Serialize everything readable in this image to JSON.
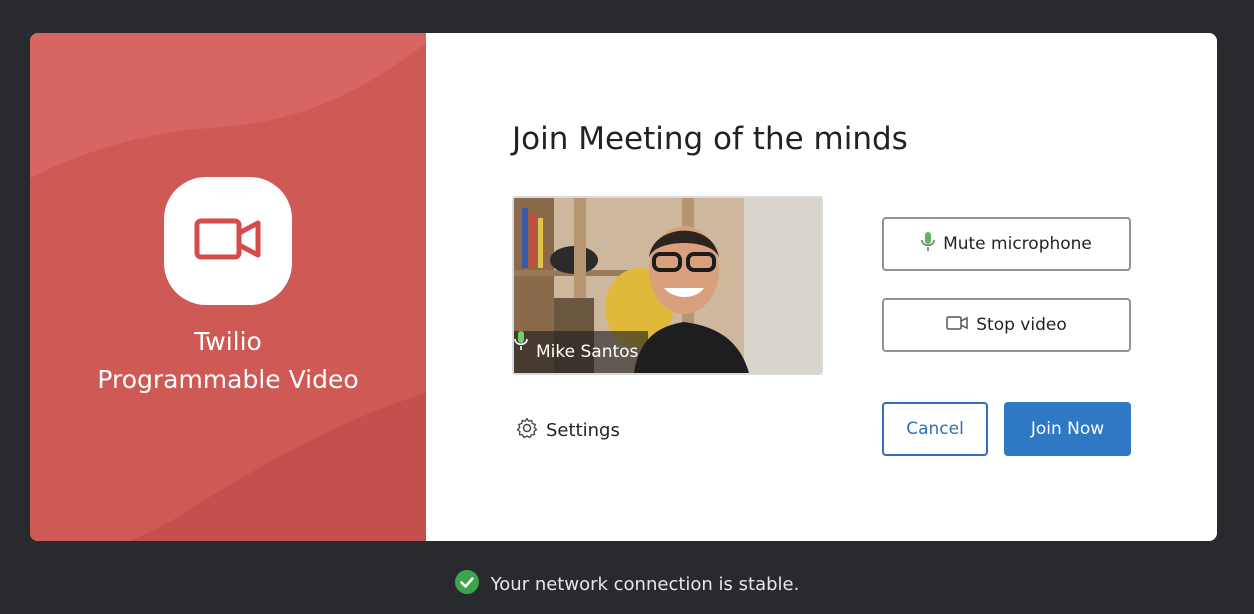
{
  "brand": {
    "line1": "Twilio",
    "line2": "Programmable Video",
    "accent": "#cf5955"
  },
  "dialog": {
    "title": "Join Meeting of the minds",
    "participant_name": "Mike Santos",
    "mute_label": "Mute microphone",
    "stop_video_label": "Stop video",
    "settings_label": "Settings",
    "cancel_label": "Cancel",
    "join_label": "Join Now"
  },
  "icons": {
    "app": "video-camera-icon",
    "mic": "microphone-icon",
    "video": "video-camera-icon",
    "settings": "gear-icon",
    "status": "check-circle-icon"
  },
  "status": {
    "message": "Your network connection is stable.",
    "color": "#3fa34d"
  },
  "colors": {
    "primary": "#2f78c4",
    "background": "#282a2d"
  }
}
